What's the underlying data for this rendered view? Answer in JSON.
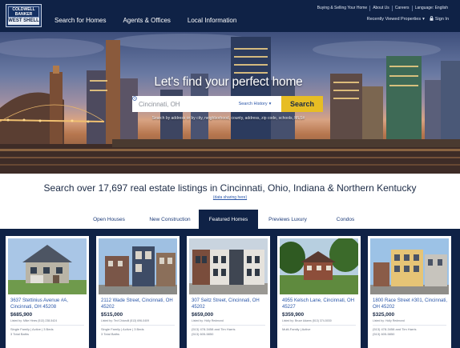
{
  "header": {
    "logo_top": "COLDWELL BANKER",
    "logo_bottom": "WEST SHELL",
    "nav_main": [
      "Search for Homes",
      "Agents & Offices",
      "Local Information"
    ],
    "nav_util": [
      "Buying & Selling Your Home",
      "About Us",
      "Careers",
      "Language: English"
    ],
    "recently_viewed": "Recently Viewed Properties",
    "sign_in": "Sign In"
  },
  "hero": {
    "title": "Let's find your perfect home",
    "search_placeholder": "Cincinnati, OH",
    "search_history": "Search History",
    "search_button": "Search",
    "hint": "Search by address or by city, neighborhood, county, address, zip code, schools, MLS#"
  },
  "headline": "Search over 17,697 real estate listings in Cincinnati, Ohio, Indiana & Northern Kentucky",
  "learn_more": "(data sharing here)",
  "tabs": [
    {
      "label": "Open Houses",
      "active": false
    },
    {
      "label": "New Construction",
      "active": false
    },
    {
      "label": "Featured Homes",
      "active": true
    },
    {
      "label": "Previews Luxury",
      "active": false
    },
    {
      "label": "Condos",
      "active": false
    }
  ],
  "listings": [
    {
      "address": "3637 Stettinius Avenue #A, Cincinnati, OH 45208",
      "price": "$685,900",
      "agent": "Listed by: Mike Hines (513) 238-5424",
      "meta1": "Single Family | Active | 3 Beds",
      "meta2": "3 Total Baths"
    },
    {
      "address": "2112 Wade Street, Cincinnati, OH 45202",
      "price": "$515,000",
      "agent": "Listed by: Ted Chiarolli (513) 696-0409",
      "meta1": "Single Family | Active | 3 Beds",
      "meta2": "3 Total Baths"
    },
    {
      "address": "307 Seitz Street, Cincinnati, OH 45202",
      "price": "$659,000",
      "agent": "Listed by: Holly Redmond",
      "meta1": "(513) 478-3458 and Tim Harris",
      "meta2": "(513) 605-5850"
    },
    {
      "address": "4955 Kelsch Lane, Cincinnati, OH 45227",
      "price": "$359,900",
      "agent": "Listed by: Bruce Adams (513) 374-5030",
      "meta1": "Multi-Family | Active",
      "meta2": ""
    },
    {
      "address": "1800 Race Street #301, Cincinnati, OH 45202",
      "price": "$325,000",
      "agent": "Listed by: Holly Redmond",
      "meta1": "(513) 478-3458 and Tim Harris",
      "meta2": "(513) 605-5850"
    }
  ]
}
